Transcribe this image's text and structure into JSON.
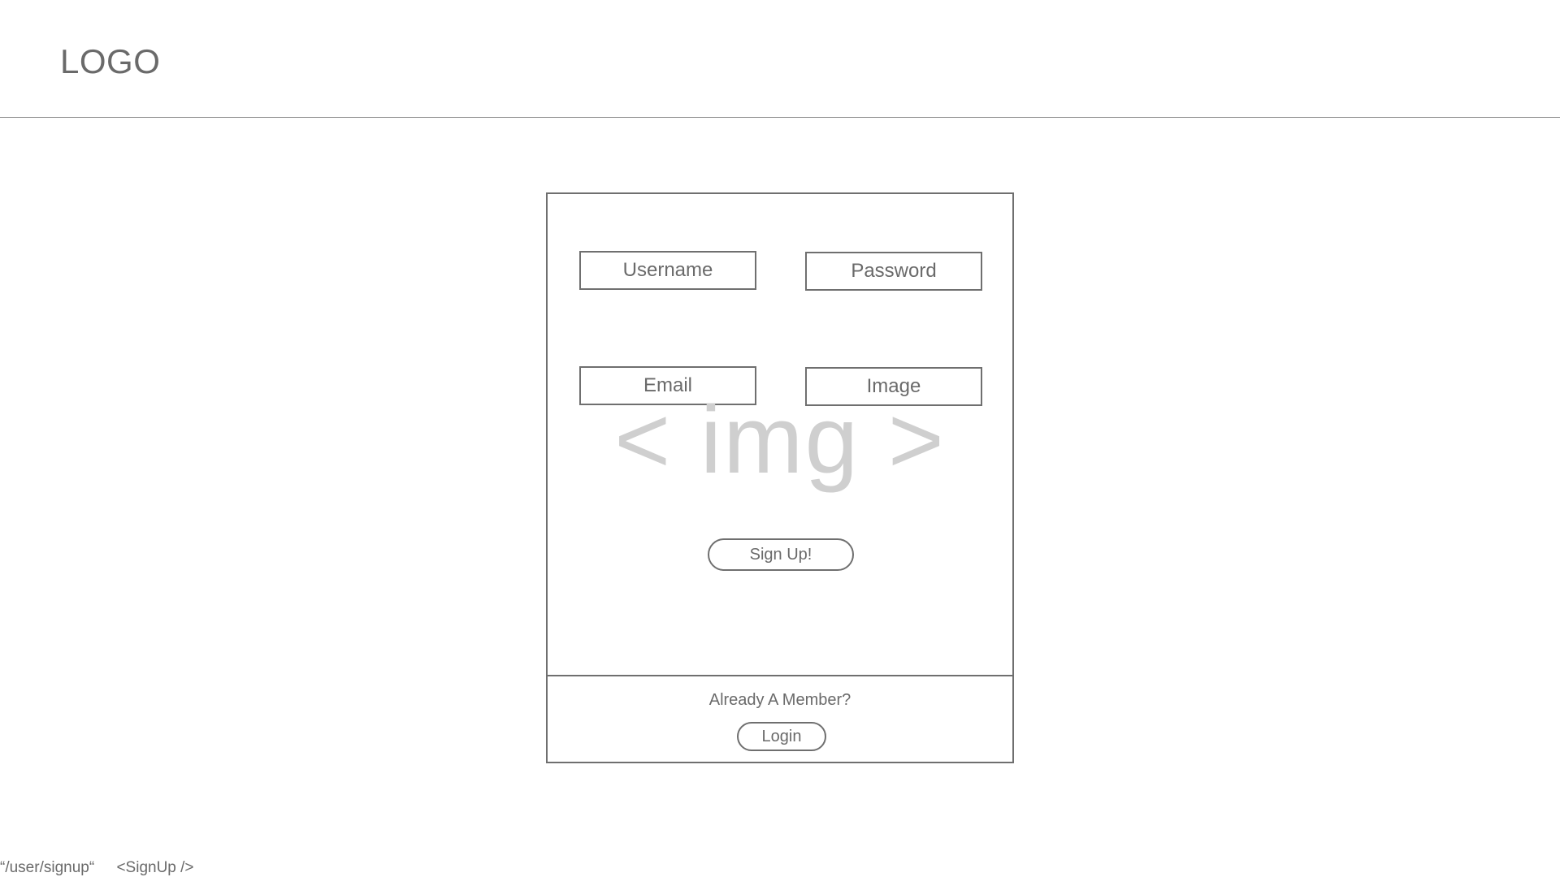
{
  "header": {
    "logo": "LOGO"
  },
  "signup_form": {
    "fields": {
      "username": "Username",
      "password": "Password",
      "email": "Email",
      "image": "Image"
    },
    "image_placeholder": "< img >",
    "signup_label": "Sign Up!"
  },
  "login_section": {
    "prompt": "Already A Member?",
    "login_label": "Login"
  },
  "footer": {
    "route": "“/user/signup“",
    "component": "<SignUp />"
  }
}
